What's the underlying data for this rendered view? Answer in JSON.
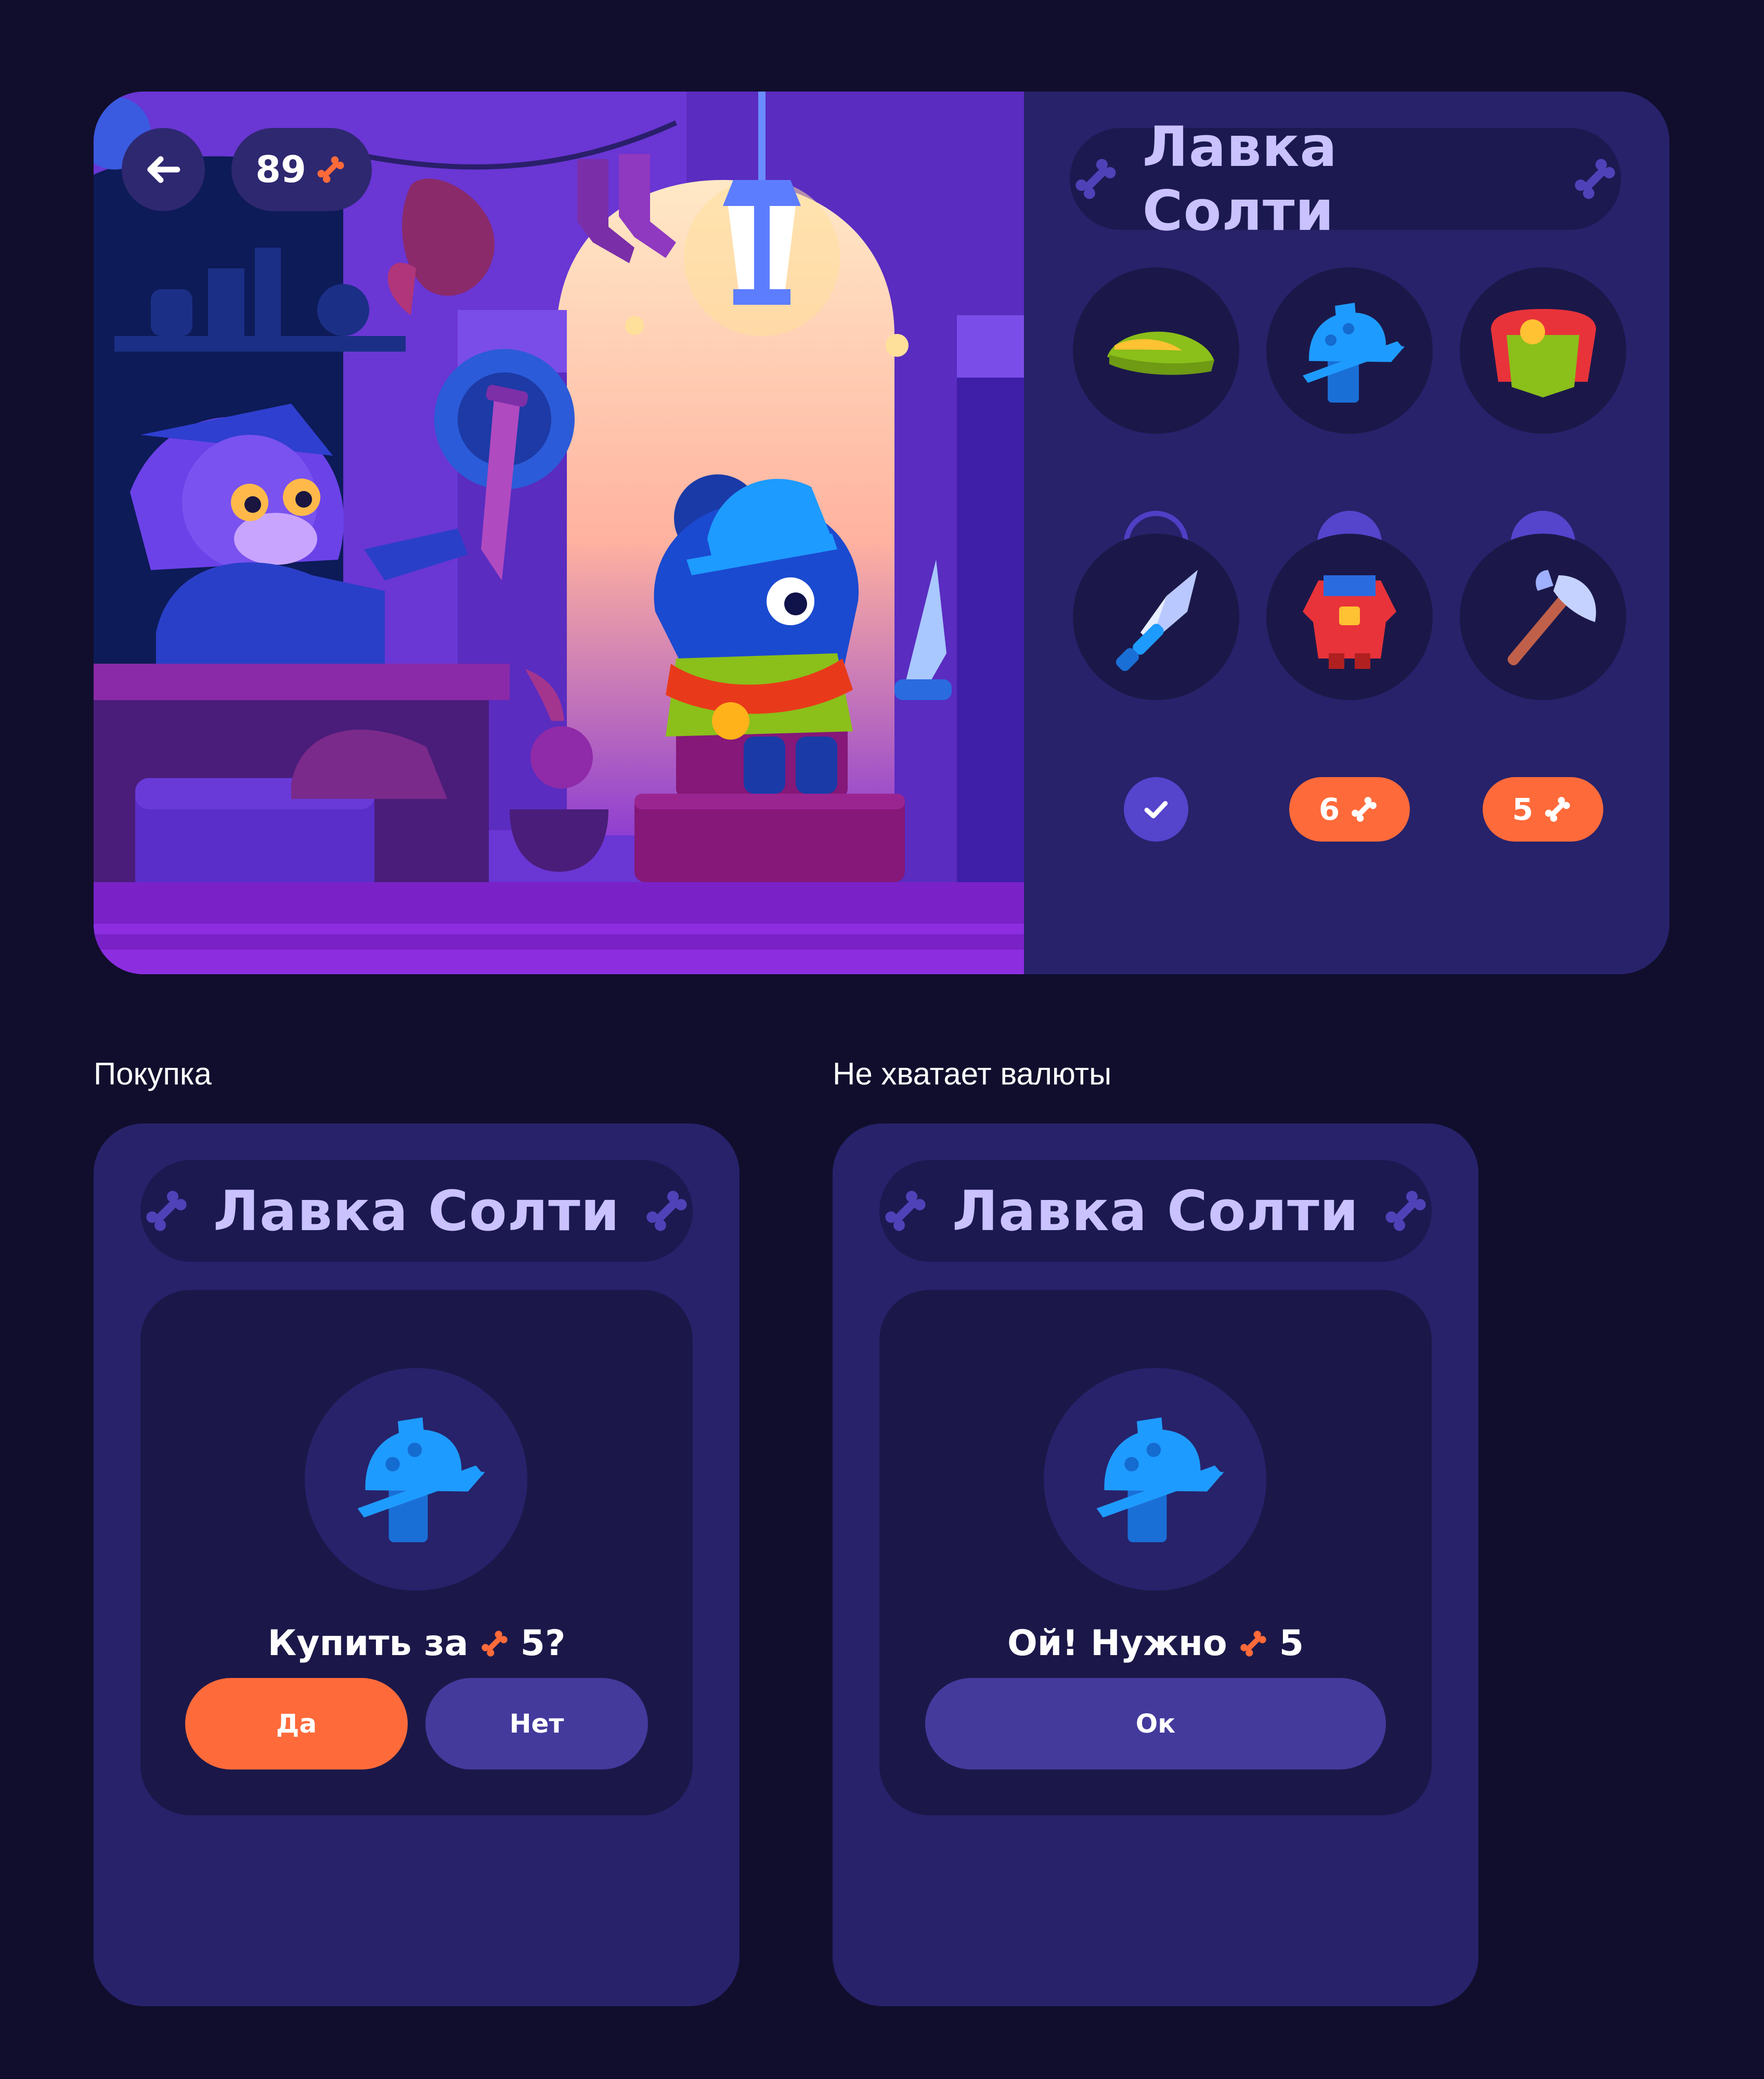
{
  "colors": {
    "background": "#110e2d",
    "card": "#27226a",
    "pill": "#1c1951",
    "accent_orange": "#ff6a3a",
    "check_purple": "#5544cc",
    "button_purple": "#433a9c",
    "title_lavender": "#c9c2ff"
  },
  "main": {
    "balance": "89",
    "balance_icon": "bone-icon",
    "back_icon": "arrow-left-icon",
    "shop_title": "Лавка Солти",
    "items": [
      {
        "name": "green feathered cap",
        "icon": "hat-icon",
        "state": "unselected"
      },
      {
        "name": "blue helmet",
        "icon": "helmet-icon",
        "state": "owned"
      },
      {
        "name": "red cape",
        "icon": "cape-icon",
        "state": "owned"
      },
      {
        "name": "sword",
        "icon": "sword-icon",
        "state": "owned"
      },
      {
        "name": "armor tunic",
        "icon": "tunic-icon",
        "state": "price",
        "price": "6"
      },
      {
        "name": "axe",
        "icon": "axe-icon",
        "state": "price",
        "price": "5"
      }
    ]
  },
  "purchase": {
    "caption": "Покупка",
    "shop_title": "Лавка Солти",
    "question_prefix": "Купить за",
    "question_amount": "5?",
    "yes_label": "Да",
    "no_label": "Нет"
  },
  "insufficient": {
    "caption": "Не хватает валюты",
    "shop_title": "Лавка Солти",
    "message_prefix": "Ой! Нужно",
    "message_amount": "5",
    "ok_label": "Ок"
  }
}
